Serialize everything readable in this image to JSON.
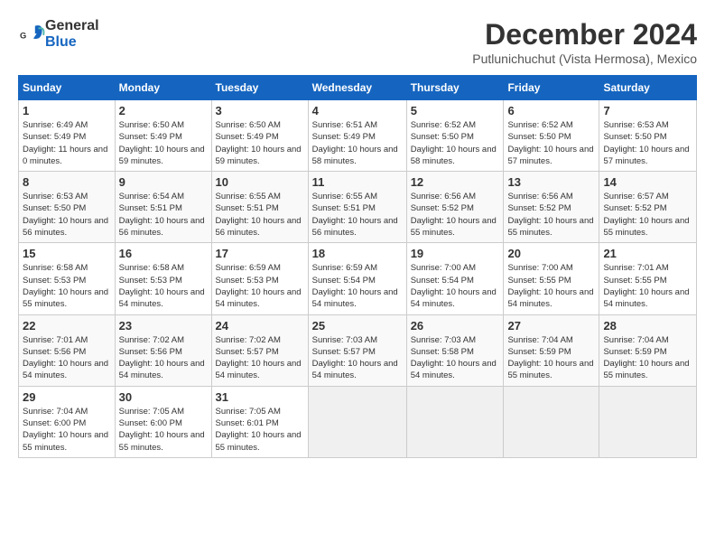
{
  "logo": {
    "general": "General",
    "blue": "Blue"
  },
  "title": "December 2024",
  "subtitle": "Putlunichuchut (Vista Hermosa), Mexico",
  "days_of_week": [
    "Sunday",
    "Monday",
    "Tuesday",
    "Wednesday",
    "Thursday",
    "Friday",
    "Saturday"
  ],
  "weeks": [
    [
      {
        "day": "1",
        "sunrise": "6:49 AM",
        "sunset": "5:49 PM",
        "daylight": "11 hours and 0 minutes."
      },
      {
        "day": "2",
        "sunrise": "6:50 AM",
        "sunset": "5:49 PM",
        "daylight": "10 hours and 59 minutes."
      },
      {
        "day": "3",
        "sunrise": "6:50 AM",
        "sunset": "5:49 PM",
        "daylight": "10 hours and 59 minutes."
      },
      {
        "day": "4",
        "sunrise": "6:51 AM",
        "sunset": "5:49 PM",
        "daylight": "10 hours and 58 minutes."
      },
      {
        "day": "5",
        "sunrise": "6:52 AM",
        "sunset": "5:50 PM",
        "daylight": "10 hours and 58 minutes."
      },
      {
        "day": "6",
        "sunrise": "6:52 AM",
        "sunset": "5:50 PM",
        "daylight": "10 hours and 57 minutes."
      },
      {
        "day": "7",
        "sunrise": "6:53 AM",
        "sunset": "5:50 PM",
        "daylight": "10 hours and 57 minutes."
      }
    ],
    [
      {
        "day": "8",
        "sunrise": "6:53 AM",
        "sunset": "5:50 PM",
        "daylight": "10 hours and 56 minutes."
      },
      {
        "day": "9",
        "sunrise": "6:54 AM",
        "sunset": "5:51 PM",
        "daylight": "10 hours and 56 minutes."
      },
      {
        "day": "10",
        "sunrise": "6:55 AM",
        "sunset": "5:51 PM",
        "daylight": "10 hours and 56 minutes."
      },
      {
        "day": "11",
        "sunrise": "6:55 AM",
        "sunset": "5:51 PM",
        "daylight": "10 hours and 56 minutes."
      },
      {
        "day": "12",
        "sunrise": "6:56 AM",
        "sunset": "5:52 PM",
        "daylight": "10 hours and 55 minutes."
      },
      {
        "day": "13",
        "sunrise": "6:56 AM",
        "sunset": "5:52 PM",
        "daylight": "10 hours and 55 minutes."
      },
      {
        "day": "14",
        "sunrise": "6:57 AM",
        "sunset": "5:52 PM",
        "daylight": "10 hours and 55 minutes."
      }
    ],
    [
      {
        "day": "15",
        "sunrise": "6:58 AM",
        "sunset": "5:53 PM",
        "daylight": "10 hours and 55 minutes."
      },
      {
        "day": "16",
        "sunrise": "6:58 AM",
        "sunset": "5:53 PM",
        "daylight": "10 hours and 54 minutes."
      },
      {
        "day": "17",
        "sunrise": "6:59 AM",
        "sunset": "5:53 PM",
        "daylight": "10 hours and 54 minutes."
      },
      {
        "day": "18",
        "sunrise": "6:59 AM",
        "sunset": "5:54 PM",
        "daylight": "10 hours and 54 minutes."
      },
      {
        "day": "19",
        "sunrise": "7:00 AM",
        "sunset": "5:54 PM",
        "daylight": "10 hours and 54 minutes."
      },
      {
        "day": "20",
        "sunrise": "7:00 AM",
        "sunset": "5:55 PM",
        "daylight": "10 hours and 54 minutes."
      },
      {
        "day": "21",
        "sunrise": "7:01 AM",
        "sunset": "5:55 PM",
        "daylight": "10 hours and 54 minutes."
      }
    ],
    [
      {
        "day": "22",
        "sunrise": "7:01 AM",
        "sunset": "5:56 PM",
        "daylight": "10 hours and 54 minutes."
      },
      {
        "day": "23",
        "sunrise": "7:02 AM",
        "sunset": "5:56 PM",
        "daylight": "10 hours and 54 minutes."
      },
      {
        "day": "24",
        "sunrise": "7:02 AM",
        "sunset": "5:57 PM",
        "daylight": "10 hours and 54 minutes."
      },
      {
        "day": "25",
        "sunrise": "7:03 AM",
        "sunset": "5:57 PM",
        "daylight": "10 hours and 54 minutes."
      },
      {
        "day": "26",
        "sunrise": "7:03 AM",
        "sunset": "5:58 PM",
        "daylight": "10 hours and 54 minutes."
      },
      {
        "day": "27",
        "sunrise": "7:04 AM",
        "sunset": "5:59 PM",
        "daylight": "10 hours and 55 minutes."
      },
      {
        "day": "28",
        "sunrise": "7:04 AM",
        "sunset": "5:59 PM",
        "daylight": "10 hours and 55 minutes."
      }
    ],
    [
      {
        "day": "29",
        "sunrise": "7:04 AM",
        "sunset": "6:00 PM",
        "daylight": "10 hours and 55 minutes."
      },
      {
        "day": "30",
        "sunrise": "7:05 AM",
        "sunset": "6:00 PM",
        "daylight": "10 hours and 55 minutes."
      },
      {
        "day": "31",
        "sunrise": "7:05 AM",
        "sunset": "6:01 PM",
        "daylight": "10 hours and 55 minutes."
      },
      null,
      null,
      null,
      null
    ]
  ]
}
